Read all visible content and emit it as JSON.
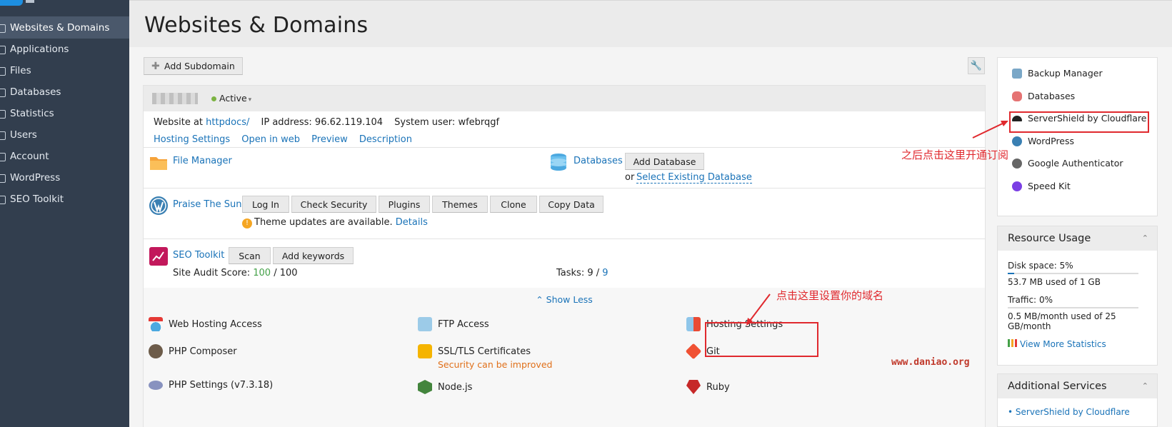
{
  "sidebar": {
    "items": [
      {
        "label": "Websites & Domains",
        "active": true
      },
      {
        "label": "Applications"
      },
      {
        "label": "Files"
      },
      {
        "label": "Databases"
      },
      {
        "label": "Statistics"
      },
      {
        "label": "Users"
      },
      {
        "label": "Account"
      },
      {
        "label": "WordPress"
      },
      {
        "label": "SEO Toolkit"
      }
    ]
  },
  "header": {
    "title": "Websites & Domains"
  },
  "toolbar": {
    "add_subdomain": "Add Subdomain"
  },
  "domain": {
    "status": "Active",
    "website_at_label": "Website at",
    "website_at_value": "httpdocs/",
    "ip_label": "IP address:",
    "ip_value": "96.62.119.104",
    "user_label": "System user:",
    "user_value": "wfebrqgf",
    "links": [
      "Hosting Settings",
      "Open in web",
      "Preview",
      "Description"
    ]
  },
  "features": {
    "file_manager": "File Manager",
    "databases": "Databases",
    "add_database": "Add Database",
    "or": "or",
    "select_existing_db": "Select Existing Database",
    "wordpress_site": "Praise The Sun",
    "wp_buttons": [
      "Log In",
      "Check Security",
      "Plugins",
      "Themes",
      "Clone",
      "Copy Data"
    ],
    "theme_updates": "Theme updates are available.",
    "details": "Details",
    "seo_toolkit": "SEO Toolkit",
    "seo_buttons": [
      "Scan",
      "Add keywords"
    ],
    "site_audit_label": "Site Audit Score:",
    "site_audit_value": "100",
    "site_audit_total": "/ 100",
    "tasks_label": "Tasks:",
    "tasks_done": "9 /",
    "tasks_total": "9",
    "show_less": "Show Less"
  },
  "tools": {
    "web_hosting_access": "Web Hosting Access",
    "ftp_access": "FTP Access",
    "hosting_settings": "Hosting Settings",
    "php_composer": "PHP Composer",
    "ssl_tls": "SSL/TLS Certificates",
    "ssl_warning": "Security can be improved",
    "git": "Git",
    "php_settings": "PHP Settings (v7.3.18)",
    "nodejs": "Node.js",
    "ruby": "Ruby"
  },
  "quick_links": [
    "Backup Manager",
    "Databases",
    "ServerShield by Cloudflare",
    "WordPress",
    "Google Authenticator",
    "Speed Kit"
  ],
  "resource_usage": {
    "title": "Resource Usage",
    "disk_label": "Disk space:",
    "disk_value": "5%",
    "disk_percent": 5,
    "disk_detail": "53.7 MB used of 1 GB",
    "traffic_label": "Traffic:",
    "traffic_value": "0%",
    "traffic_percent": 0,
    "traffic_detail_1": "0.5 MB/month used of 25",
    "traffic_detail_2": "GB/month",
    "view_more": "View More Statistics"
  },
  "additional_services": {
    "title": "Additional Services",
    "items": [
      "ServerShield by Cloudflare"
    ]
  },
  "annotations": {
    "subscribe_note": "之后点击这里开通订阅",
    "domain_note": "点击这里设置你的域名",
    "watermark": "www.daniao.org"
  },
  "colors": {
    "sidebar": "#323e4e",
    "link": "#1a73b8",
    "annotation": "#e0292e",
    "active_status": "#7cb342",
    "warning": "#e0701a"
  }
}
